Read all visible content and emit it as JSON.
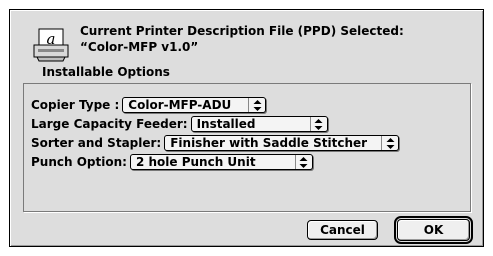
{
  "header": {
    "title_line1": "Current Printer Description File (PPD) Selected:",
    "title_line2": "“Color-MFP v1.0”",
    "icon": "printer-description-icon"
  },
  "section": {
    "label": "Installable Options"
  },
  "options": [
    {
      "label": "Copier Type :",
      "value": "Color-MFP-ADU"
    },
    {
      "label": "Large Capacity Feeder:",
      "value": "Installed"
    },
    {
      "label": "Sorter and Stapler:",
      "value": "Finisher with Saddle Stitcher"
    },
    {
      "label": "Punch Option:",
      "value": "2 hole Punch Unit"
    }
  ],
  "buttons": {
    "cancel": "Cancel",
    "ok": "OK"
  }
}
